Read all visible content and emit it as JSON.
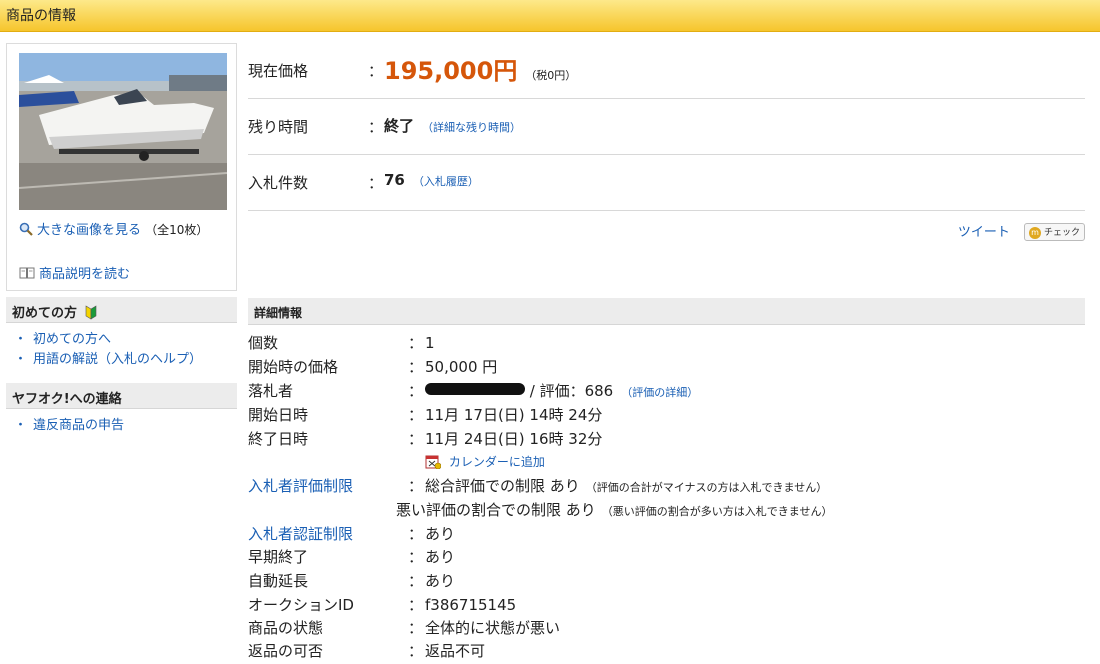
{
  "header": {
    "title": "商品の情報"
  },
  "image_box": {
    "view_large": "大きな画像を見る",
    "count_note": "（全10枚）",
    "read_description": "商品説明を読む"
  },
  "beginners": {
    "title": "初めての方",
    "links": [
      "初めての方へ",
      "用語の解説（入札のヘルプ）"
    ]
  },
  "contact": {
    "title": "ヤフオク!への連絡",
    "links": [
      "違反商品の申告"
    ]
  },
  "price_rows": [
    {
      "label": "現在価格",
      "colon": "：",
      "value": "195,000円",
      "note": "（税0円）"
    },
    {
      "label": "残り時間",
      "colon": "：",
      "value": "終了",
      "link": "（詳細な残り時間）"
    },
    {
      "label": "入札件数",
      "colon": "：",
      "value": "76",
      "link": "（入札履歴）"
    }
  ],
  "social": {
    "tweet": "ツイート",
    "check": "チェック"
  },
  "details": {
    "title": "詳細情報",
    "rows": [
      {
        "key": "個数",
        "colon": "：",
        "value": "1"
      },
      {
        "key": "開始時の価格",
        "colon": "：",
        "value": "50,000 円"
      },
      {
        "key": "落札者",
        "colon": "：",
        "value": " / 評価：686",
        "link": "（評価の詳細）"
      },
      {
        "key": "開始日時",
        "colon": "：",
        "value": "11月 17日(日) 14時 24分"
      },
      {
        "key": "終了日時",
        "colon": "：",
        "value": "11月 24日(日) 16時 32分"
      }
    ],
    "calendar": "カレンダーに追加",
    "rating_limit": {
      "key": "入札者評価制限",
      "colon": "：",
      "line1": "総合評価での制限 あり",
      "note1": "（評価の合計がマイナスの方は入札できません）",
      "line2": "悪い評価の割合での制限 あり",
      "note2": "（悪い評価の割合が多い方は入札できません）"
    },
    "auth_limit": {
      "key": "入札者認証制限",
      "colon": "：",
      "value": "あり"
    },
    "rows2": [
      {
        "key": "早期終了",
        "colon": "：",
        "value": "あり"
      },
      {
        "key": "自動延長",
        "colon": "：",
        "value": "あり"
      },
      {
        "key": "オークションID",
        "colon": "：",
        "value": "f386715145"
      },
      {
        "key": "商品の状態",
        "colon": "：",
        "value": "全体的に状態が悪い"
      },
      {
        "key": "返品の可否",
        "colon": "：",
        "value": "返品不可"
      }
    ]
  }
}
